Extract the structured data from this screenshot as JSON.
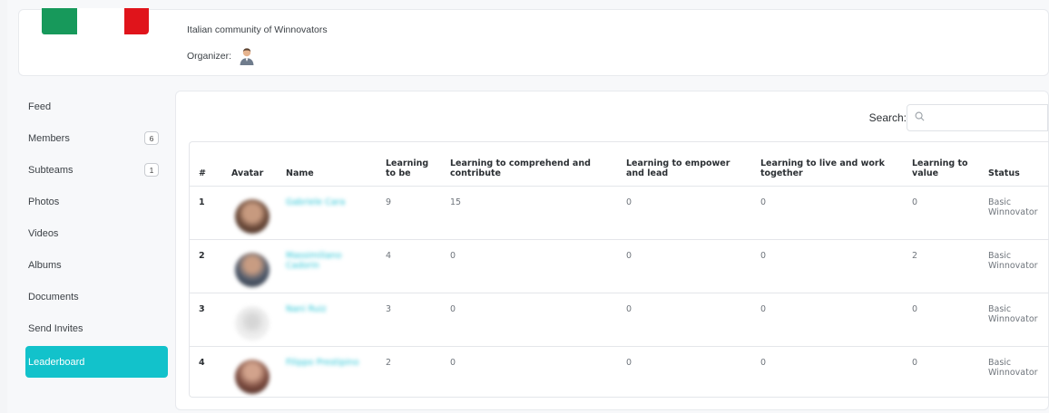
{
  "group": {
    "description": "Italian community of Winnovators",
    "organizer_label": "Organizer:"
  },
  "sidebar": {
    "items": [
      {
        "label": "Feed",
        "badge": null
      },
      {
        "label": "Members",
        "badge": "6"
      },
      {
        "label": "Subteams",
        "badge": "1"
      },
      {
        "label": "Photos",
        "badge": null
      },
      {
        "label": "Videos",
        "badge": null
      },
      {
        "label": "Albums",
        "badge": null
      },
      {
        "label": "Documents",
        "badge": null
      },
      {
        "label": "Send Invites",
        "badge": null
      },
      {
        "label": "Leaderboard",
        "badge": null,
        "active": true
      }
    ]
  },
  "search": {
    "label": "Search:",
    "placeholder": ""
  },
  "table": {
    "headers": {
      "rank": "#",
      "avatar": "Avatar",
      "name": "Name",
      "learn_be": "Learning to be",
      "learn_comprehend": "Learning to comprehend and contribute",
      "learn_empower": "Learning to empower and lead",
      "learn_live": "Learning to live and work together",
      "learn_value": "Learning to value",
      "status": "Status"
    },
    "rows": [
      {
        "rank": "1",
        "name": "Gabriele Cara",
        "be": "9",
        "comprehend": "15",
        "empower": "0",
        "live": "0",
        "value": "0",
        "status": "Basic Winnovator",
        "avatar_color": "#6b4a3a"
      },
      {
        "rank": "2",
        "name": "Massimiliano Cadorin",
        "be": "4",
        "comprehend": "0",
        "empower": "0",
        "live": "0",
        "value": "2",
        "status": "Basic Winnovator",
        "avatar_color": "#4f5a6b"
      },
      {
        "rank": "3",
        "name": "Nani Ruiz",
        "be": "3",
        "comprehend": "0",
        "empower": "0",
        "live": "0",
        "value": "0",
        "status": "Basic Winnovator",
        "avatar_color": "#e8e8e8"
      },
      {
        "rank": "4",
        "name": "Filippo Prestipino",
        "be": "2",
        "comprehend": "0",
        "empower": "0",
        "live": "0",
        "value": "0",
        "status": "Basic Winnovator",
        "avatar_color": "#7b4b3f"
      }
    ]
  },
  "colors": {
    "accent": "#12c2cb",
    "link": "#29c5d6",
    "flag_green": "#17995b",
    "flag_red": "#e0141b"
  }
}
